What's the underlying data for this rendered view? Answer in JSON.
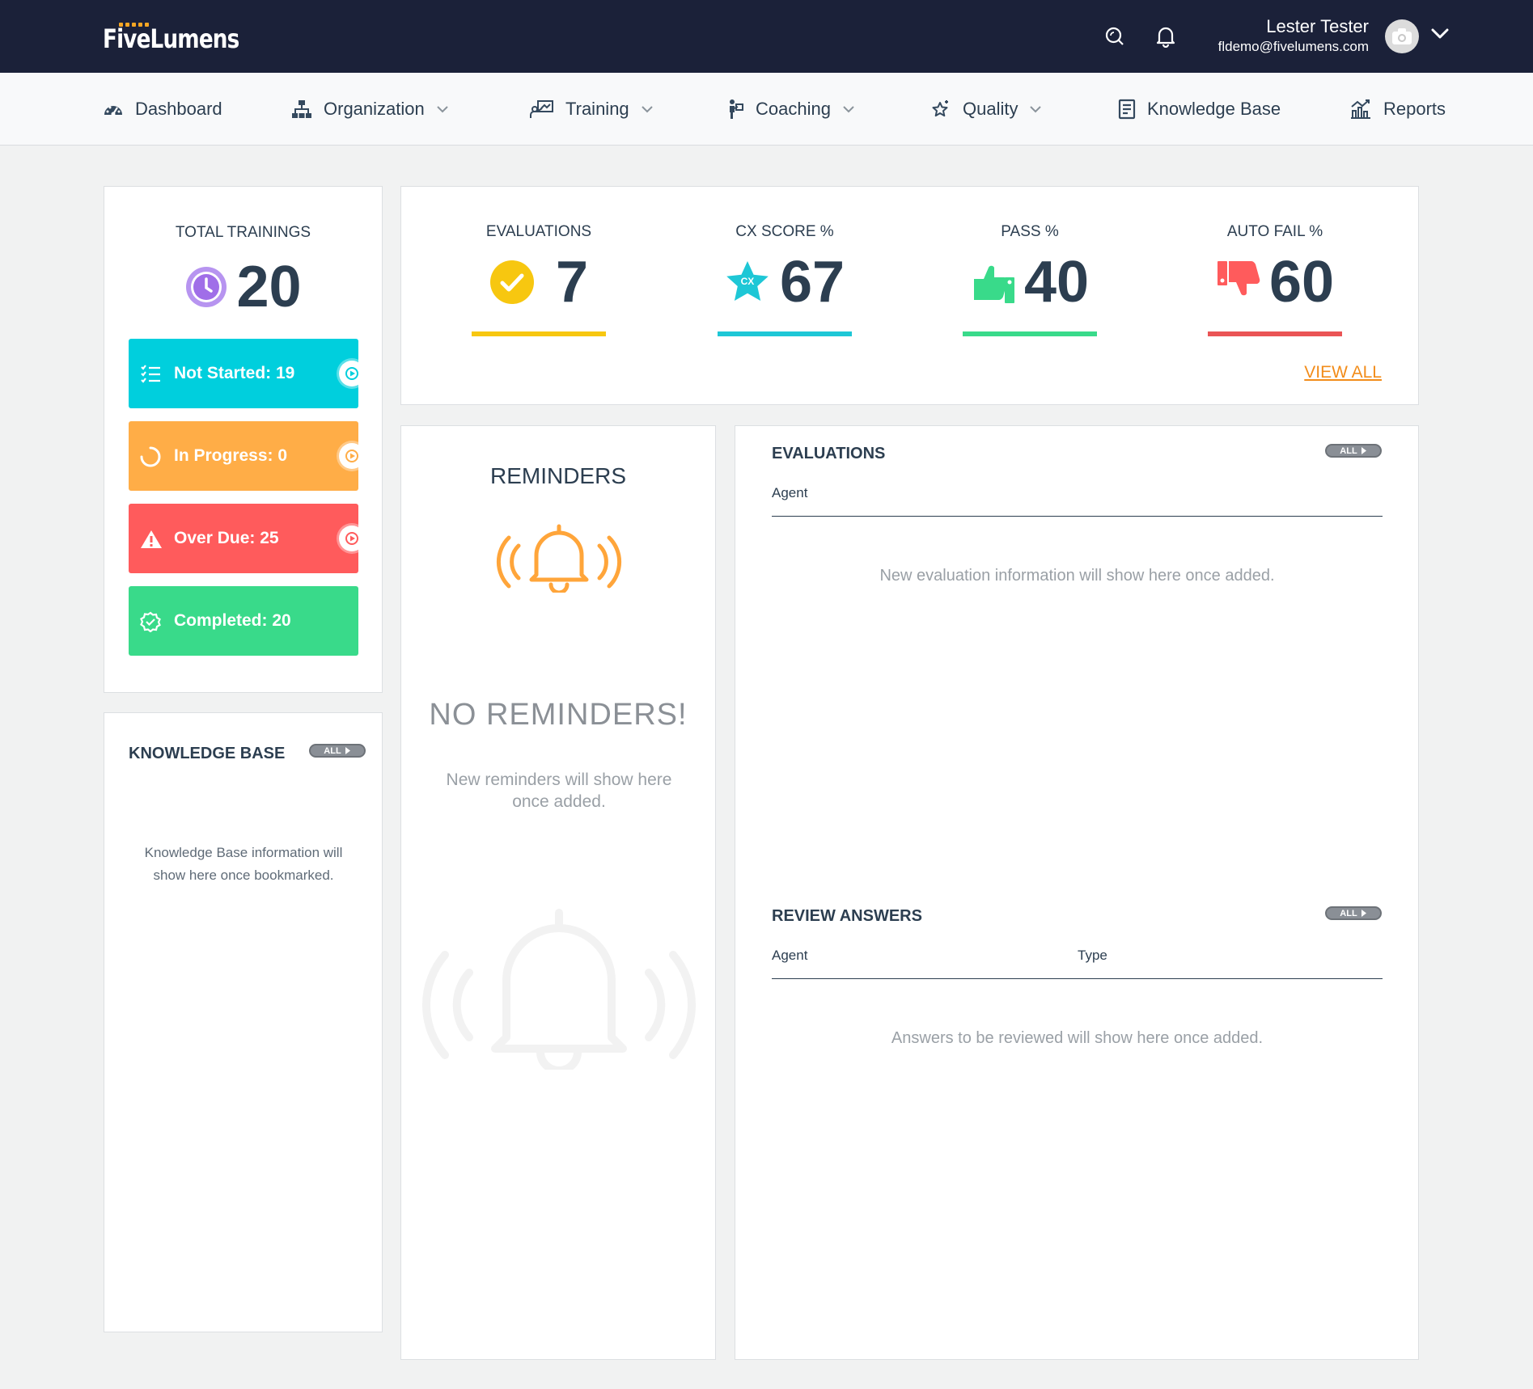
{
  "app": {
    "logo": "FiveLumens"
  },
  "user": {
    "name": "Lester Tester",
    "email": "fldemo@fivelumens.com"
  },
  "nav": {
    "dashboard": "Dashboard",
    "organization": "Organization",
    "training": "Training",
    "coaching": "Coaching",
    "quality": "Quality",
    "knowledge_base": "Knowledge Base",
    "reports": "Reports"
  },
  "trainings": {
    "title": "TOTAL TRAININGS",
    "total": "20",
    "not_started": "Not Started: 19",
    "in_progress": "In Progress: 0",
    "over_due": "Over Due: 25",
    "completed": "Completed: 20"
  },
  "metrics": {
    "evaluations": {
      "label": "EVALUATIONS",
      "value": "7"
    },
    "cx_score": {
      "label": "CX SCORE %",
      "value": "67",
      "badge": "CX"
    },
    "pass": {
      "label": "PASS %",
      "value": "40"
    },
    "auto_fail": {
      "label": "AUTO FAIL %",
      "value": "60"
    },
    "view_all": "VIEW ALL"
  },
  "reminders": {
    "title": "REMINDERS",
    "empty_title": "NO REMINDERS!",
    "empty_text": "New reminders will show here once added."
  },
  "knowledge_base": {
    "title": "KNOWLEDGE BASE",
    "all": "ALL",
    "empty_text": "Knowledge Base information will show here once bookmarked."
  },
  "evaluations_panel": {
    "title": "EVALUATIONS",
    "all": "ALL",
    "col_agent": "Agent",
    "empty_text": "New evaluation information will show here once added."
  },
  "review_answers": {
    "title": "REVIEW ANSWERS",
    "all": "ALL",
    "col_agent": "Agent",
    "col_type": "Type",
    "empty_text": "Answers to be reviewed will show here once added."
  },
  "colors": {
    "topbar": "#1b2139",
    "cyan": "#00cfdd",
    "orange": "#ffad47",
    "red": "#ff5b5c",
    "green": "#39da8a",
    "yellow": "#f7c710",
    "purple": "#a06ee8",
    "link": "#f28c1a"
  },
  "icons": [
    "search-icon",
    "bell-icon",
    "avatar-camera-icon",
    "chevron-down-icon",
    "dashboard-gauge-icon",
    "organization-icon",
    "training-icon",
    "coaching-icon",
    "quality-icon",
    "book-icon",
    "reports-icon",
    "clock-icon",
    "list-icon",
    "spinner-icon",
    "warning-icon",
    "badge-check-icon",
    "play-icon",
    "check-circle-icon",
    "star-icon",
    "thumbs-up-icon",
    "thumbs-down-icon",
    "ringing-bell-icon"
  ]
}
